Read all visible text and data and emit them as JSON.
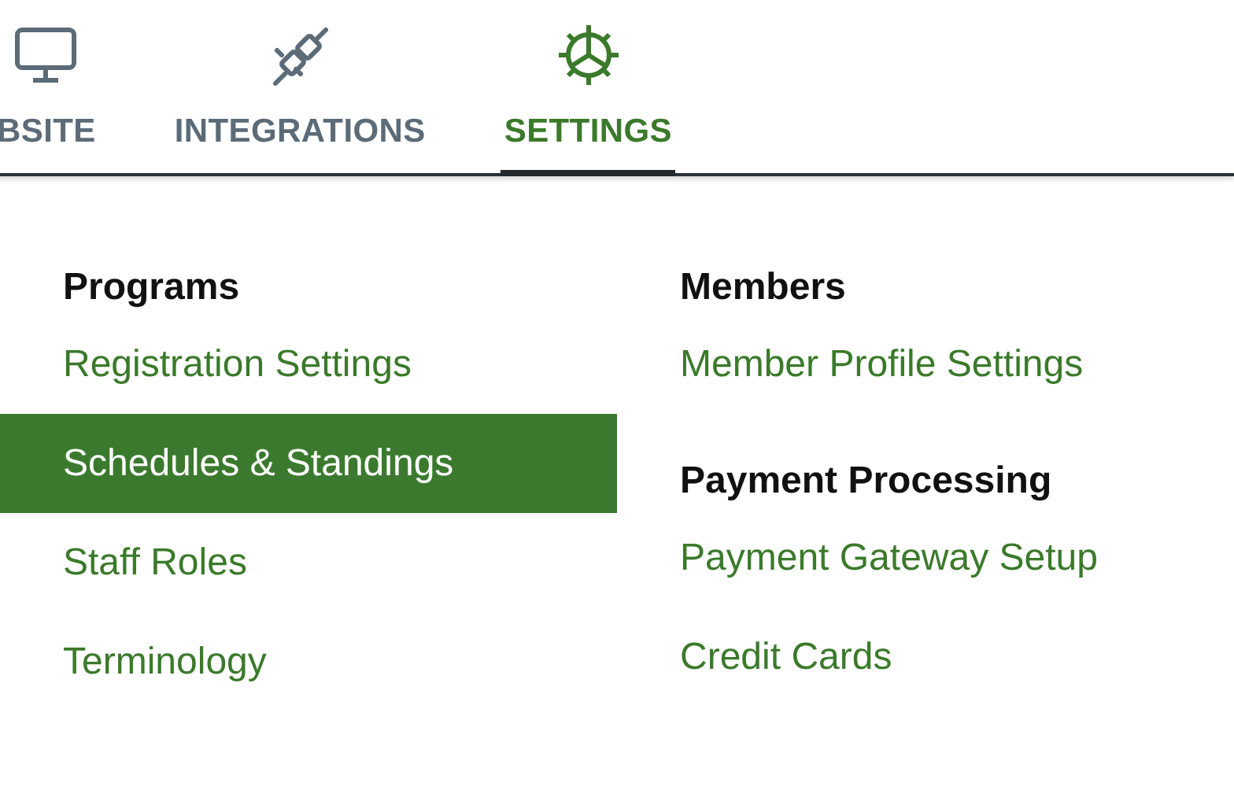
{
  "tabs": [
    {
      "kind": "website",
      "label": "BSITE",
      "selected": false
    },
    {
      "kind": "integrations",
      "label": "INTEGRATIONS",
      "selected": false
    },
    {
      "kind": "settings",
      "label": "SETTINGS",
      "selected": true
    }
  ],
  "menu_columns": [
    {
      "sections": [
        {
          "heading": "Programs",
          "items": [
            {
              "label": "Registration Settings",
              "selected": false
            },
            {
              "label": "Schedules & Standings",
              "selected": true
            },
            {
              "label": "Staff Roles",
              "selected": false
            },
            {
              "label": "Terminology",
              "selected": false
            }
          ]
        }
      ]
    },
    {
      "sections": [
        {
          "heading": "Members",
          "items": [
            {
              "label": "Member Profile Settings",
              "selected": false
            }
          ]
        },
        {
          "heading": "Payment Processing",
          "items": [
            {
              "label": "Payment Gateway Setup",
              "selected": false
            },
            {
              "label": "Credit Cards",
              "selected": false
            }
          ]
        }
      ]
    }
  ]
}
